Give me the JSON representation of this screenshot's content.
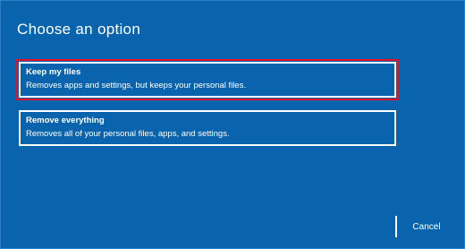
{
  "dialog": {
    "title": "Choose an option"
  },
  "options": [
    {
      "title": "Keep my files",
      "description": "Removes apps and settings, but keeps your personal files.",
      "focused": true
    },
    {
      "title": "Remove everything",
      "description": "Removes all of your personal files, apps, and settings.",
      "focused": false
    }
  ],
  "footer": {
    "cancel_label": "Cancel"
  },
  "colors": {
    "background": "#0a64ad",
    "focus_outline": "#e81123",
    "text": "#ffffff"
  }
}
